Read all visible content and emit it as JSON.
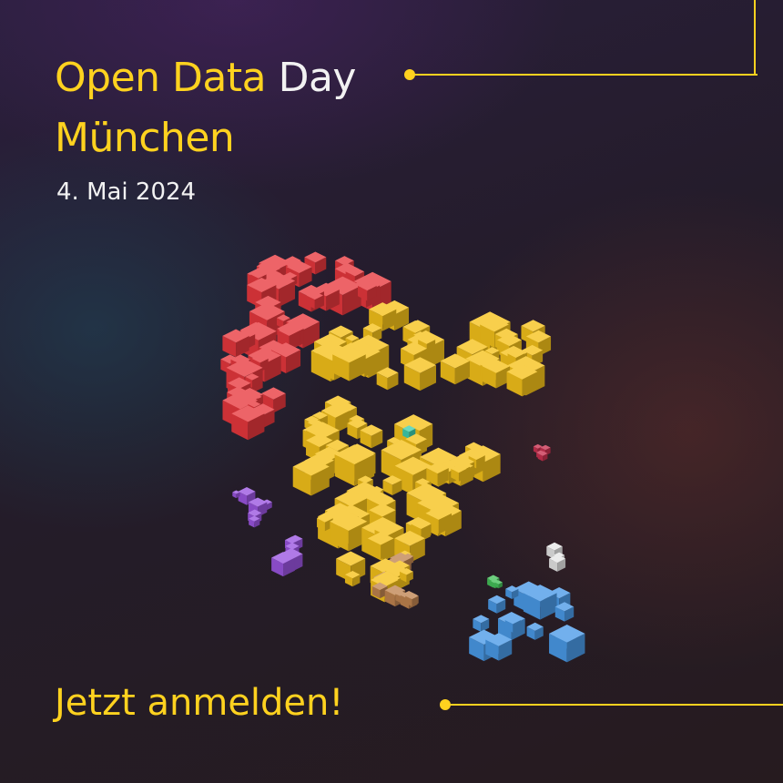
{
  "poster": {
    "title_part1": "Open Data",
    "title_part2": "Day",
    "title_line2": "München",
    "date": "4. Mai 2024",
    "cta": "Jetzt anmelden!"
  },
  "colors": {
    "accent": "#ffd21f",
    "text": "#f2f2f2",
    "cube_red": "#e8383d",
    "cube_yellow": "#f6c21a",
    "cube_purple": "#9a55e0",
    "cube_blue": "#4a9ae8",
    "cube_brown": "#c08450",
    "cube_green": "#44c05a",
    "cube_teal": "#3ecfb0",
    "cube_white": "#e6e6e6",
    "cube_magenta": "#c8314f"
  },
  "graphics": {
    "cube_cluster": "voxel-cube-cluster"
  }
}
